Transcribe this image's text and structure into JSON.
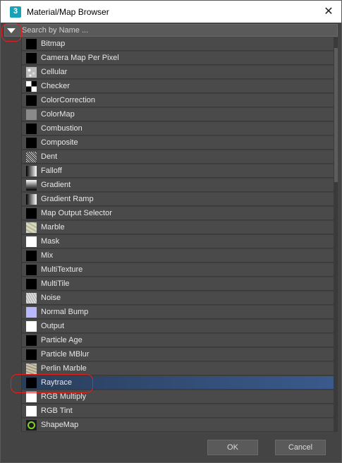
{
  "window": {
    "title": "Material/Map Browser",
    "app_icon_glyph": "3",
    "close_glyph": "✕"
  },
  "search": {
    "placeholder": "Search by Name ..."
  },
  "maps": [
    {
      "label": "Bitmap",
      "swatch": "black",
      "selected": false
    },
    {
      "label": "Camera Map Per Pixel",
      "swatch": "black",
      "selected": false
    },
    {
      "label": "Cellular",
      "swatch": "cellular",
      "selected": false
    },
    {
      "label": "Checker",
      "swatch": "checker",
      "selected": false
    },
    {
      "label": "ColorCorrection",
      "swatch": "black",
      "selected": false
    },
    {
      "label": "ColorMap",
      "swatch": "gray",
      "selected": false
    },
    {
      "label": "Combustion",
      "swatch": "black",
      "selected": false
    },
    {
      "label": "Composite",
      "swatch": "black",
      "selected": false
    },
    {
      "label": "Dent",
      "swatch": "dent",
      "selected": false
    },
    {
      "label": "Falloff",
      "swatch": "falloff",
      "selected": false
    },
    {
      "label": "Gradient",
      "swatch": "gradient",
      "selected": false
    },
    {
      "label": "Gradient Ramp",
      "swatch": "gradient-ramp",
      "selected": false
    },
    {
      "label": "Map Output Selector",
      "swatch": "black",
      "selected": false
    },
    {
      "label": "Marble",
      "swatch": "marble",
      "selected": false
    },
    {
      "label": "Mask",
      "swatch": "white",
      "selected": false
    },
    {
      "label": "Mix",
      "swatch": "black",
      "selected": false
    },
    {
      "label": "MultiTexture",
      "swatch": "black",
      "selected": false
    },
    {
      "label": "MultiTile",
      "swatch": "black",
      "selected": false
    },
    {
      "label": "Noise",
      "swatch": "noise",
      "selected": false
    },
    {
      "label": "Normal Bump",
      "swatch": "normal-bump",
      "selected": false
    },
    {
      "label": "Output",
      "swatch": "white",
      "selected": false
    },
    {
      "label": "Particle Age",
      "swatch": "black",
      "selected": false
    },
    {
      "label": "Particle MBlur",
      "swatch": "black",
      "selected": false
    },
    {
      "label": "Perlin Marble",
      "swatch": "perlin",
      "selected": false
    },
    {
      "label": "Raytrace",
      "swatch": "black",
      "selected": true
    },
    {
      "label": "RGB Multiply",
      "swatch": "white",
      "selected": false
    },
    {
      "label": "RGB Tint",
      "swatch": "white",
      "selected": false
    },
    {
      "label": "ShapeMap",
      "swatch": "shapemap",
      "selected": false
    }
  ],
  "swatch_colors": {
    "black": "#000000",
    "white": "#ffffff",
    "gray": "#8a8a8a",
    "normal-bump": "#b8b8ff",
    "shapemap_bg": "#1a1a1a",
    "shapemap_fg": "#7ed321"
  },
  "colors": {
    "annotation_red": "#e32020",
    "selected_row": "#3a5a8c"
  },
  "buttons": {
    "ok_label": "OK",
    "cancel_label": "Cancel"
  }
}
